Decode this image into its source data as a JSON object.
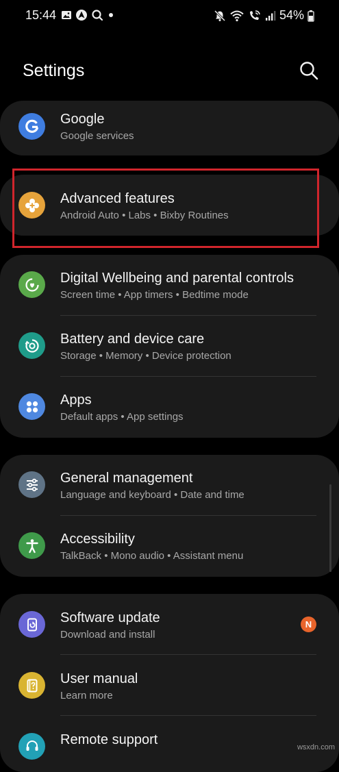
{
  "status_bar": {
    "time": "15:44",
    "battery": "54%",
    "left_icons": [
      "gallery-icon",
      "android-auto-icon",
      "search-notification-icon",
      "dot-icon"
    ],
    "right_icons": [
      "mute-icon",
      "wifi-icon",
      "wifi-calling-icon",
      "signal-icon",
      "battery-icon"
    ]
  },
  "header": {
    "title": "Settings",
    "search_icon": "search-icon"
  },
  "colors": {
    "background": "#000000",
    "card": "#1b1b1b",
    "google": "#3f7de0",
    "advanced": "#e6a33b",
    "wellbeing": "#5aa94a",
    "battery": "#1f9c8a",
    "apps": "#4f88e0",
    "general": "#5f7386",
    "accessibility": "#3f9a4a",
    "software": "#6a67d6",
    "manual": "#d9b432",
    "remote": "#22a1b6",
    "highlight": "#d0252c",
    "badge": "#e8642b"
  },
  "groups": [
    {
      "rows": [
        {
          "title": "Google",
          "subtitle": "Google services",
          "icon": "google-icon"
        }
      ]
    },
    {
      "rows": [
        {
          "title": "Advanced features",
          "subtitle": "Android Auto  •  Labs  •  Bixby Routines",
          "icon": "advanced-features-icon"
        }
      ]
    },
    {
      "rows": [
        {
          "title": "Digital Wellbeing and parental controls",
          "subtitle": "Screen time  •  App timers  •  Bedtime mode",
          "icon": "digital-wellbeing-icon"
        },
        {
          "title": "Battery and device care",
          "subtitle": "Storage  •  Memory  •  Device protection",
          "icon": "device-care-icon"
        },
        {
          "title": "Apps",
          "subtitle": "Default apps  •  App settings",
          "icon": "apps-icon"
        }
      ]
    },
    {
      "rows": [
        {
          "title": "General management",
          "subtitle": "Language and keyboard  •  Date and time",
          "icon": "general-management-icon"
        },
        {
          "title": "Accessibility",
          "subtitle": "TalkBack  •  Mono audio  •  Assistant menu",
          "icon": "accessibility-icon"
        }
      ]
    },
    {
      "rows": [
        {
          "title": "Software update",
          "subtitle": "Download and install",
          "icon": "software-update-icon",
          "badge": "N"
        },
        {
          "title": "User manual",
          "subtitle": "Learn more",
          "icon": "user-manual-icon"
        },
        {
          "title": "Remote support",
          "subtitle": "",
          "icon": "remote-support-icon"
        }
      ]
    }
  ],
  "watermark": "wsxdn.com"
}
